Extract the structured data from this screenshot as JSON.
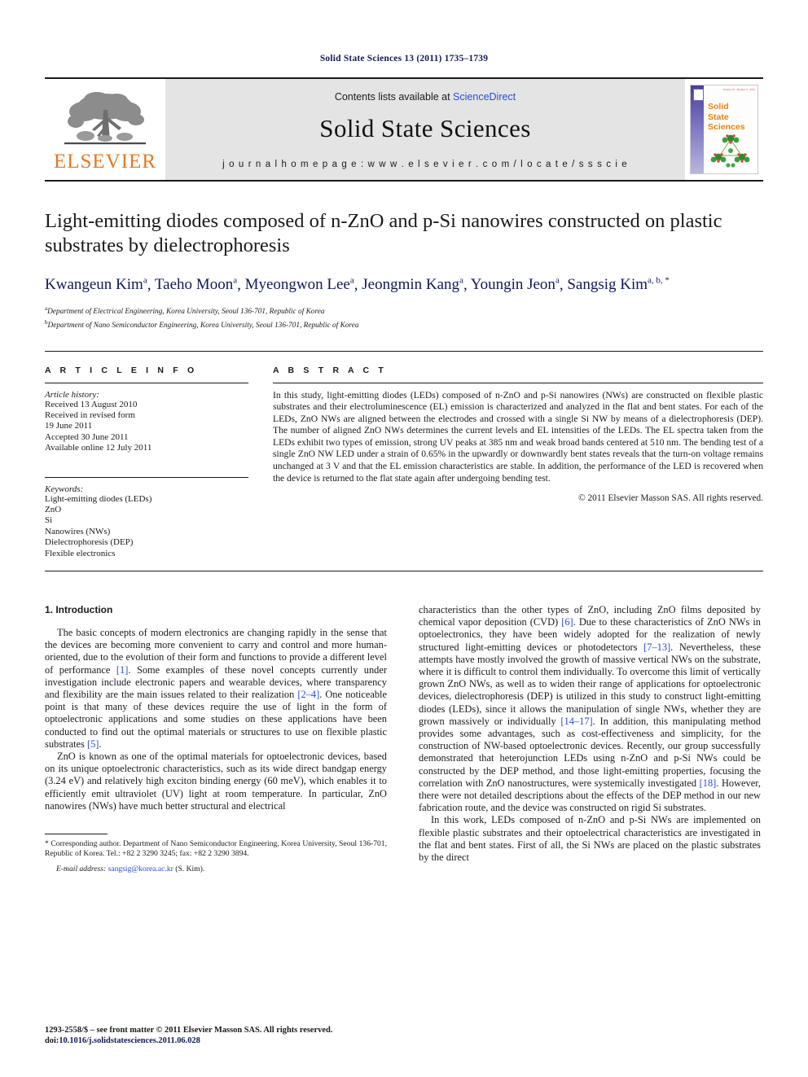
{
  "running_head": "Solid State Sciences 13 (2011) 1735–1739",
  "masthead": {
    "publisher_logo_text": "ELSEVIER",
    "contents_prefix": "Contents lists available at ",
    "contents_link": "ScienceDirect",
    "journal_name": "Solid State Sciences",
    "homepage": "j o u r n a l   h o m e p a g e :   w w w . e l s e v i e r . c o m / l o c a t e / s s s c i e",
    "cover": {
      "title_line1": "Solid",
      "title_line2": "State",
      "title_line3": "Sciences",
      "issue_tag": "Volume 13 · Number 9 · 2011"
    }
  },
  "article": {
    "title": "Light-emitting diodes composed of n-ZnO and p-Si nanowires constructed on plastic substrates by dielectrophoresis",
    "authors": [
      {
        "name": "Kwangeun Kim",
        "marks": "a"
      },
      {
        "name": "Taeho Moon",
        "marks": "a"
      },
      {
        "name": "Myeongwon Lee",
        "marks": "a"
      },
      {
        "name": "Jeongmin Kang",
        "marks": "a"
      },
      {
        "name": "Youngin Jeon",
        "marks": "a"
      },
      {
        "name": "Sangsig Kim",
        "marks": "a, b, *"
      }
    ],
    "affiliations": [
      {
        "mark": "a",
        "text": "Department of Electrical Engineering, Korea University, Seoul 136-701, Republic of Korea"
      },
      {
        "mark": "b",
        "text": "Department of Nano Semiconductor Engineering, Korea University, Seoul 136-701, Republic of Korea"
      }
    ]
  },
  "article_info": {
    "heading": "A R T I C L E   I N F O",
    "history_label": "Article history:",
    "history": [
      "Received 13 August 2010",
      "Received in revised form",
      "19 June 2011",
      "Accepted 30 June 2011",
      "Available online 12 July 2011"
    ],
    "keywords_label": "Keywords:",
    "keywords": [
      "Light-emitting diodes (LEDs)",
      "ZnO",
      "Si",
      "Nanowires (NWs)",
      "Dielectrophoresis (DEP)",
      "Flexible electronics"
    ]
  },
  "abstract": {
    "heading": "A B S T R A C T",
    "text": "In this study, light-emitting diodes (LEDs) composed of n-ZnO and p-Si nanowires (NWs) are constructed on flexible plastic substrates and their electroluminescence (EL) emission is characterized and analyzed in the flat and bent states. For each of the LEDs, ZnO NWs are aligned between the electrodes and crossed with a single Si NW by means of a dielectrophoresis (DEP). The number of aligned ZnO NWs determines the current levels and EL intensities of the LEDs. The EL spectra taken from the LEDs exhibit two types of emission, strong UV peaks at 385 nm and weak broad bands centered at 510 nm. The bending test of a single ZnO NW LED under a strain of 0.65% in the upwardly or downwardly bent states reveals that the turn-on voltage remains unchanged at 3 V and that the EL emission characteristics are stable. In addition, the performance of the LED is recovered when the device is returned to the flat state again after undergoing bending test.",
    "copyright": "© 2011 Elsevier Masson SAS. All rights reserved."
  },
  "body": {
    "section_number_title": "1.  Introduction",
    "left_para_1_a": "The basic concepts of modern electronics are changing rapidly in the sense that the devices are becoming more convenient to carry and control and more human-oriented, due to the evolution of their form and functions to provide a different level of performance ",
    "left_para_1_ref1": "[1]",
    "left_para_1_b": ". Some examples of these novel concepts currently under investigation include electronic papers and wearable devices, where transparency and flexibility are the main issues related to their realization ",
    "left_para_1_ref2": "[2–4]",
    "left_para_1_c": ". One noticeable point is that many of these devices require the use of light in the form of optoelectronic applications and some studies on these applications have been conducted to find out the optimal materials or structures to use on flexible plastic substrates ",
    "left_para_1_ref3": "[5]",
    "left_para_1_d": ".",
    "left_para_2": "ZnO is known as one of the optimal materials for optoelectronic devices, based on its unique optoelectronic characteristics, such as its wide direct bandgap energy (3.24 eV) and relatively high exciton binding energy (60 meV), which enables it to efficiently emit ultraviolet (UV) light at room temperature. In particular, ZnO nanowires (NWs) have much better structural and electrical",
    "right_para_1_a": "characteristics than the other types of ZnO, including ZnO films deposited by chemical vapor deposition (CVD) ",
    "right_para_1_ref1": "[6]",
    "right_para_1_b": ". Due to these characteristics of ZnO NWs in optoelectronics, they have been widely adopted for the realization of newly structured light-emitting devices or photodetectors ",
    "right_para_1_ref2": "[7–13]",
    "right_para_1_c": ". Nevertheless, these attempts have mostly involved the growth of massive vertical NWs on the substrate, where it is difficult to control them individually. To overcome this limit of vertically grown ZnO NWs, as well as to widen their range of applications for optoelectronic devices, dielectrophoresis (DEP) is utilized in this study to construct light-emitting diodes (LEDs), since it allows the manipulation of single NWs, whether they are grown massively or individually ",
    "right_para_1_ref3": "[14–17]",
    "right_para_1_d": ". In addition, this manipulating method provides some advantages, such as cost-effectiveness and simplicity, for the construction of NW-based optoelectronic devices. Recently, our group successfully demonstrated that heterojunction LEDs using n-ZnO and p-Si NWs could be constructed by the DEP method, and those light-emitting properties, focusing the correlation with ZnO nanostructures, were systemically investigated ",
    "right_para_1_ref4": "[18]",
    "right_para_1_e": ". However, there were not detailed descriptions about the effects of the DEP method in our new fabrication route, and the device was constructed on rigid Si substrates.",
    "right_para_2": "In this work, LEDs composed of n-ZnO and p-Si NWs are implemented on flexible plastic substrates and their optoelectrical characteristics are investigated in the flat and bent states. First of all, the Si NWs are placed on the plastic substrates by the direct"
  },
  "footnote": {
    "corresponding": "* Corresponding author. Department of Nano Semiconductor Engineering, Korea University, Seoul 136-701, Republic of Korea. Tel.: +82 2 3290 3245; fax: +82 2 3290 3894.",
    "email_label": "E-mail address:",
    "email": "sangsig@korea.ac.kr",
    "email_suffix": "(S. Kim)."
  },
  "issn_footer": {
    "line1": "1293-2558/$ – see front matter © 2011 Elsevier Masson SAS. All rights reserved.",
    "doi_label": "doi:",
    "doi_value": "10.1016/j.solidstatesciences.2011.06.028"
  },
  "colors": {
    "link_blue": "#2a4bd7",
    "heading_navy": "#111a54",
    "elsevier_orange": "#e87722",
    "masthead_gray": "#e4e4e4"
  }
}
